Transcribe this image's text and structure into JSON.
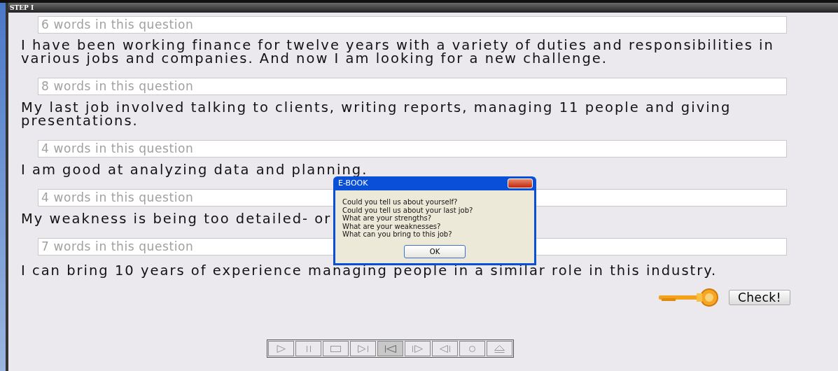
{
  "window": {
    "title": "STEP I"
  },
  "questions": [
    {
      "placeholder": "6 words in this question",
      "answer": "I have been working finance for twelve years with a variety of duties and responsibilities in various jobs and companies. And now I am looking for a new challenge."
    },
    {
      "placeholder": "8 words in this question",
      "answer": "My last job involved talking to clients, writing reports, managing 11 people and giving presentations."
    },
    {
      "placeholder": "4 words in this question",
      "answer": "I am good at analyzing data and planning."
    },
    {
      "placeholder": "4 words in this question",
      "answer": "My weakness is being too detailed- or"
    },
    {
      "placeholder": "7 words in this question",
      "answer": "I can bring 10 years of experience managing people in a similar role in this industry."
    }
  ],
  "check_button": "Check!",
  "player_buttons": [
    {
      "kind": "play",
      "selected": false
    },
    {
      "kind": "pause",
      "selected": false
    },
    {
      "kind": "stop",
      "selected": false
    },
    {
      "kind": "next",
      "selected": false
    },
    {
      "kind": "first",
      "selected": true
    },
    {
      "kind": "step-forward",
      "selected": false
    },
    {
      "kind": "step-back",
      "selected": false
    },
    {
      "kind": "record",
      "selected": false
    },
    {
      "kind": "eject",
      "selected": false
    }
  ],
  "dialog": {
    "title": "E-BOOK",
    "lines": [
      "Could you tell us about yourself?",
      "Could you tell us about your last job?",
      "What are your strengths?",
      "What are your weaknesses?",
      "What can you bring to this job?"
    ],
    "button": "OK"
  }
}
